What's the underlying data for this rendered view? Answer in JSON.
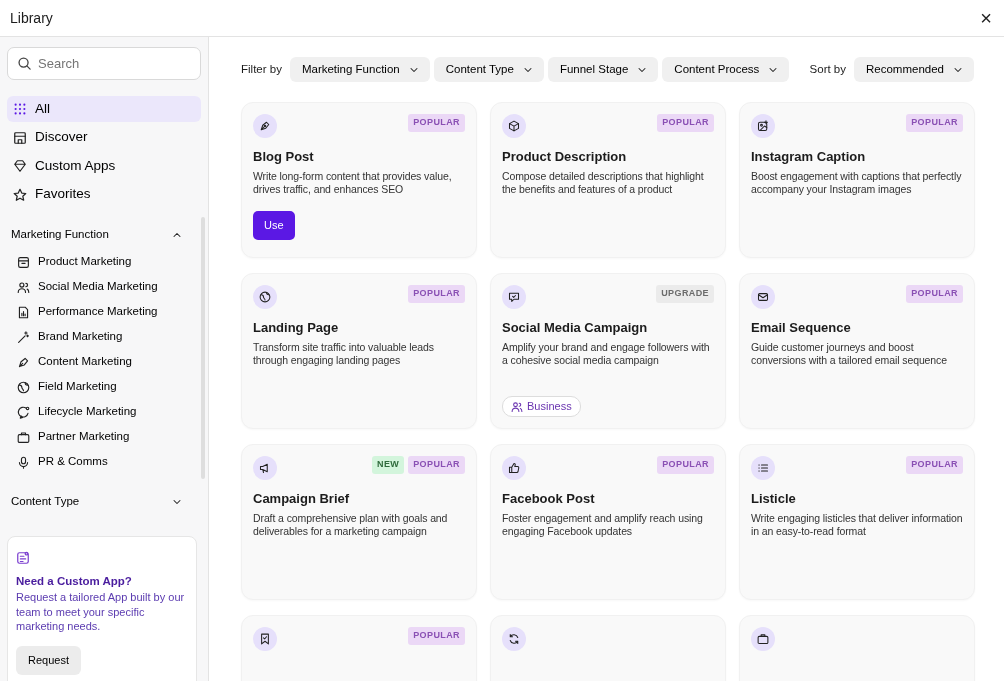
{
  "window": {
    "title": "Library",
    "close": "×"
  },
  "sidebar": {
    "search": {
      "placeholder": "Search"
    },
    "nav": [
      {
        "label": "All",
        "selected": true
      },
      {
        "label": "Discover",
        "selected": false
      },
      {
        "label": "Custom Apps",
        "selected": false
      },
      {
        "label": "Favorites",
        "selected": false
      }
    ],
    "sections": [
      {
        "label": "Marketing Function",
        "expanded": true,
        "items": [
          "Product Marketing",
          "Social Media Marketing",
          "Performance Marketing",
          "Brand Marketing",
          "Content Marketing",
          "Field Marketing",
          "Lifecycle Marketing",
          "Partner Marketing",
          "PR & Comms"
        ]
      },
      {
        "label": "Content Type",
        "expanded": false
      }
    ],
    "promo": {
      "title": "Need a Custom App?",
      "text": "Request a tailored App built by our team to meet your specific marketing needs.",
      "button": "Request"
    }
  },
  "filters": {
    "label": "Filter by",
    "options": [
      "Marketing Function",
      "Content Type",
      "Funnel Stage",
      "Content Process"
    ],
    "sort_label": "Sort by",
    "sort": "Recommended"
  },
  "cards": [
    {
      "kind": "app",
      "title": "Blog Post",
      "description": "Write long-form content that provides value, drives traffic, and enhances SEO",
      "badges": [
        {
          "label": "POPULAR",
          "kind": "popular"
        }
      ],
      "button": "Use"
    },
    {
      "kind": "app",
      "title": "Product Description",
      "description": "Compose detailed descriptions that highlight the benefits and features of a product",
      "badges": [
        {
          "label": "POPULAR",
          "kind": "popular"
        }
      ]
    },
    {
      "kind": "app",
      "title": "Instagram Caption",
      "description": "Boost engagement with captions that perfectly accompany your Instagram images",
      "badges": [
        {
          "label": "POPULAR",
          "kind": "popular"
        }
      ]
    },
    {
      "kind": "app",
      "title": "Landing Page",
      "description": "Transform site traffic into valuable leads through engaging landing pages",
      "badges": [
        {
          "label": "POPULAR",
          "kind": "popular"
        }
      ]
    },
    {
      "kind": "app",
      "title": "Social Media Campaign",
      "description": "Amplify your brand and engage followers with a cohesive social media campaign",
      "badges": [
        {
          "label": "UPGRADE",
          "kind": "upgrade"
        }
      ],
      "tag": "Business"
    },
    {
      "kind": "app",
      "title": "Email Sequence",
      "description": "Guide customer journeys and boost conversions with a tailored email sequence",
      "badges": [
        {
          "label": "POPULAR",
          "kind": "popular"
        }
      ]
    },
    {
      "kind": "app",
      "title": "Campaign Brief",
      "description": "Draft a comprehensive plan with goals and deliverables for a marketing campaign",
      "badges": [
        {
          "label": "NEW",
          "kind": "new"
        },
        {
          "label": "POPULAR",
          "kind": "popular"
        }
      ]
    },
    {
      "kind": "app",
      "title": "Facebook Post",
      "description": "Foster engagement and amplify reach using engaging Facebook updates",
      "badges": [
        {
          "label": "POPULAR",
          "kind": "popular"
        }
      ]
    },
    {
      "kind": "app",
      "title": "Listicle",
      "description": "Write engaging listicles that deliver information in an easy-to-read format",
      "badges": [
        {
          "label": "POPULAR",
          "kind": "popular"
        }
      ]
    },
    {
      "kind": "app",
      "badges": [
        {
          "label": "POPULAR",
          "kind": "popular"
        }
      ]
    },
    {
      "kind": "app"
    },
    {
      "kind": "app"
    }
  ]
}
